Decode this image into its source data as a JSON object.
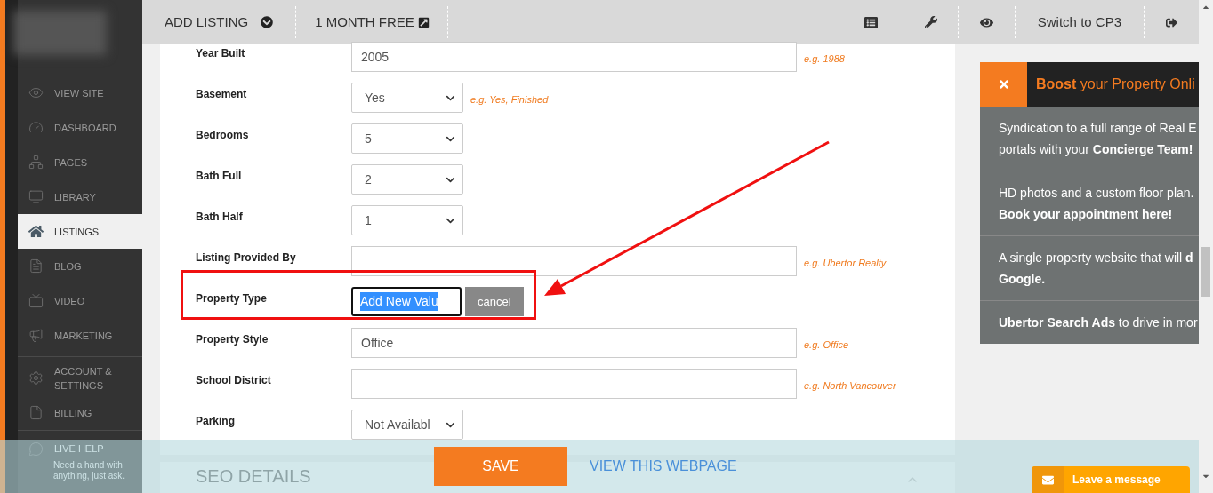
{
  "sidebar": {
    "groups": [
      [
        {
          "label": "VIEW SITE",
          "selected": false
        },
        {
          "label": "DASHBOARD",
          "selected": false
        },
        {
          "label": "PAGES",
          "selected": false
        },
        {
          "label": "LIBRARY",
          "selected": false
        },
        {
          "label": "LISTINGS",
          "selected": true
        },
        {
          "label": "BLOG",
          "selected": false
        },
        {
          "label": "VIDEO",
          "selected": false
        },
        {
          "label": "MARKETING",
          "selected": false
        }
      ],
      [
        {
          "label": "ACCOUNT & SETTINGS",
          "selected": false
        },
        {
          "label": "BILLING",
          "selected": false
        }
      ]
    ],
    "live_help": {
      "title": "LIVE HELP",
      "text": "Need a hand with anything, just ask."
    }
  },
  "top_bar": {
    "left": [
      {
        "label": "ADD LISTING",
        "kind": "dropdown"
      },
      {
        "label": "1 MONTH FREE",
        "kind": "external"
      }
    ],
    "switch_label": "Switch to CP3"
  },
  "form": {
    "rows": [
      {
        "label": "Year Built",
        "kind": "text",
        "value": "2005",
        "hint": "e.g. 1988"
      },
      {
        "label": "Basement",
        "kind": "select",
        "value": "Yes",
        "hint": "e.g. Yes, Finished"
      },
      {
        "label": "Bedrooms",
        "kind": "select",
        "value": "5"
      },
      {
        "label": "Bath Full",
        "kind": "select",
        "value": "2"
      },
      {
        "label": "Bath Half",
        "kind": "select",
        "value": "1"
      },
      {
        "label": "Listing Provided By",
        "kind": "text",
        "value": "",
        "hint": "e.g. Ubertor Realty"
      },
      {
        "label": "Property Type",
        "kind": "editing",
        "value": "Add New Valu",
        "text_selected": true,
        "button": "cancel",
        "annotated": true
      },
      {
        "label": "Property Style",
        "kind": "text",
        "value": "Office",
        "hint": "e.g. Office"
      },
      {
        "label": "School District",
        "kind": "text",
        "value": "",
        "hint": "e.g. North Vancouver"
      },
      {
        "label": "Parking",
        "kind": "select",
        "value": "Not Availabl"
      }
    ],
    "next_section": "SEO DETAILS"
  },
  "promo": {
    "title_bold": "Boost",
    "title_rest": "your Property Onli",
    "items": [
      {
        "lines": [
          "Syndication to a full range of Real E",
          "portals with your **Concierge Team!**"
        ]
      },
      {
        "lines": [
          "HD photos and a custom floor plan.",
          "**Book your appointment here!**"
        ]
      },
      {
        "lines": [
          "A single property website that will **d**",
          "**Google.**"
        ]
      },
      {
        "lines": [
          "**Ubertor Search Ads** to drive in mor"
        ]
      }
    ]
  },
  "action_bar": {
    "save": "SAVE",
    "view_link": "VIEW THIS WEBPAGE"
  },
  "chat_button": "Leave a message"
}
